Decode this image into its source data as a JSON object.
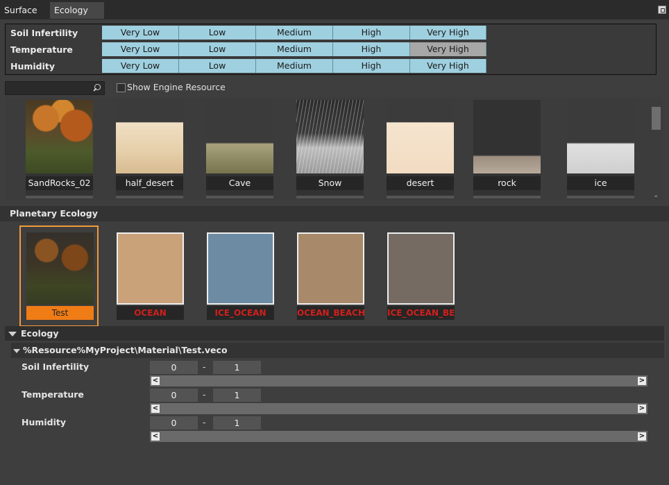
{
  "tabs": [
    "Surface",
    "Ecology"
  ],
  "conditions": {
    "rows": [
      "Soil Infertility",
      "Temperature",
      "Humidity"
    ],
    "levels": [
      "Very Low",
      "Low",
      "Medium",
      "High",
      "Very High"
    ]
  },
  "search": {
    "placeholder": "",
    "show_engine_label": "Show Engine Resource"
  },
  "resources": [
    "SandRocks_02",
    "half_desert",
    "Cave",
    "Snow",
    "desert",
    "rock",
    "ice"
  ],
  "planetary": {
    "title": "Planetary Ecology",
    "items": [
      "Test",
      "OCEAN",
      "ICE_OCEAN",
      "OCEAN_BEACH",
      "ICE_OCEAN_BEACH"
    ]
  },
  "ecology": {
    "title": "Ecology",
    "path": "%Resource%MyProject\\Material\\Test.veco",
    "params": [
      {
        "label": "Soil Infertility",
        "min": "0",
        "max": "1"
      },
      {
        "label": "Temperature",
        "min": "0",
        "max": "1"
      },
      {
        "label": "Humidity",
        "min": "0",
        "max": "1"
      }
    ],
    "separator": "-",
    "left_arrow": "<",
    "right_arrow": ">"
  }
}
